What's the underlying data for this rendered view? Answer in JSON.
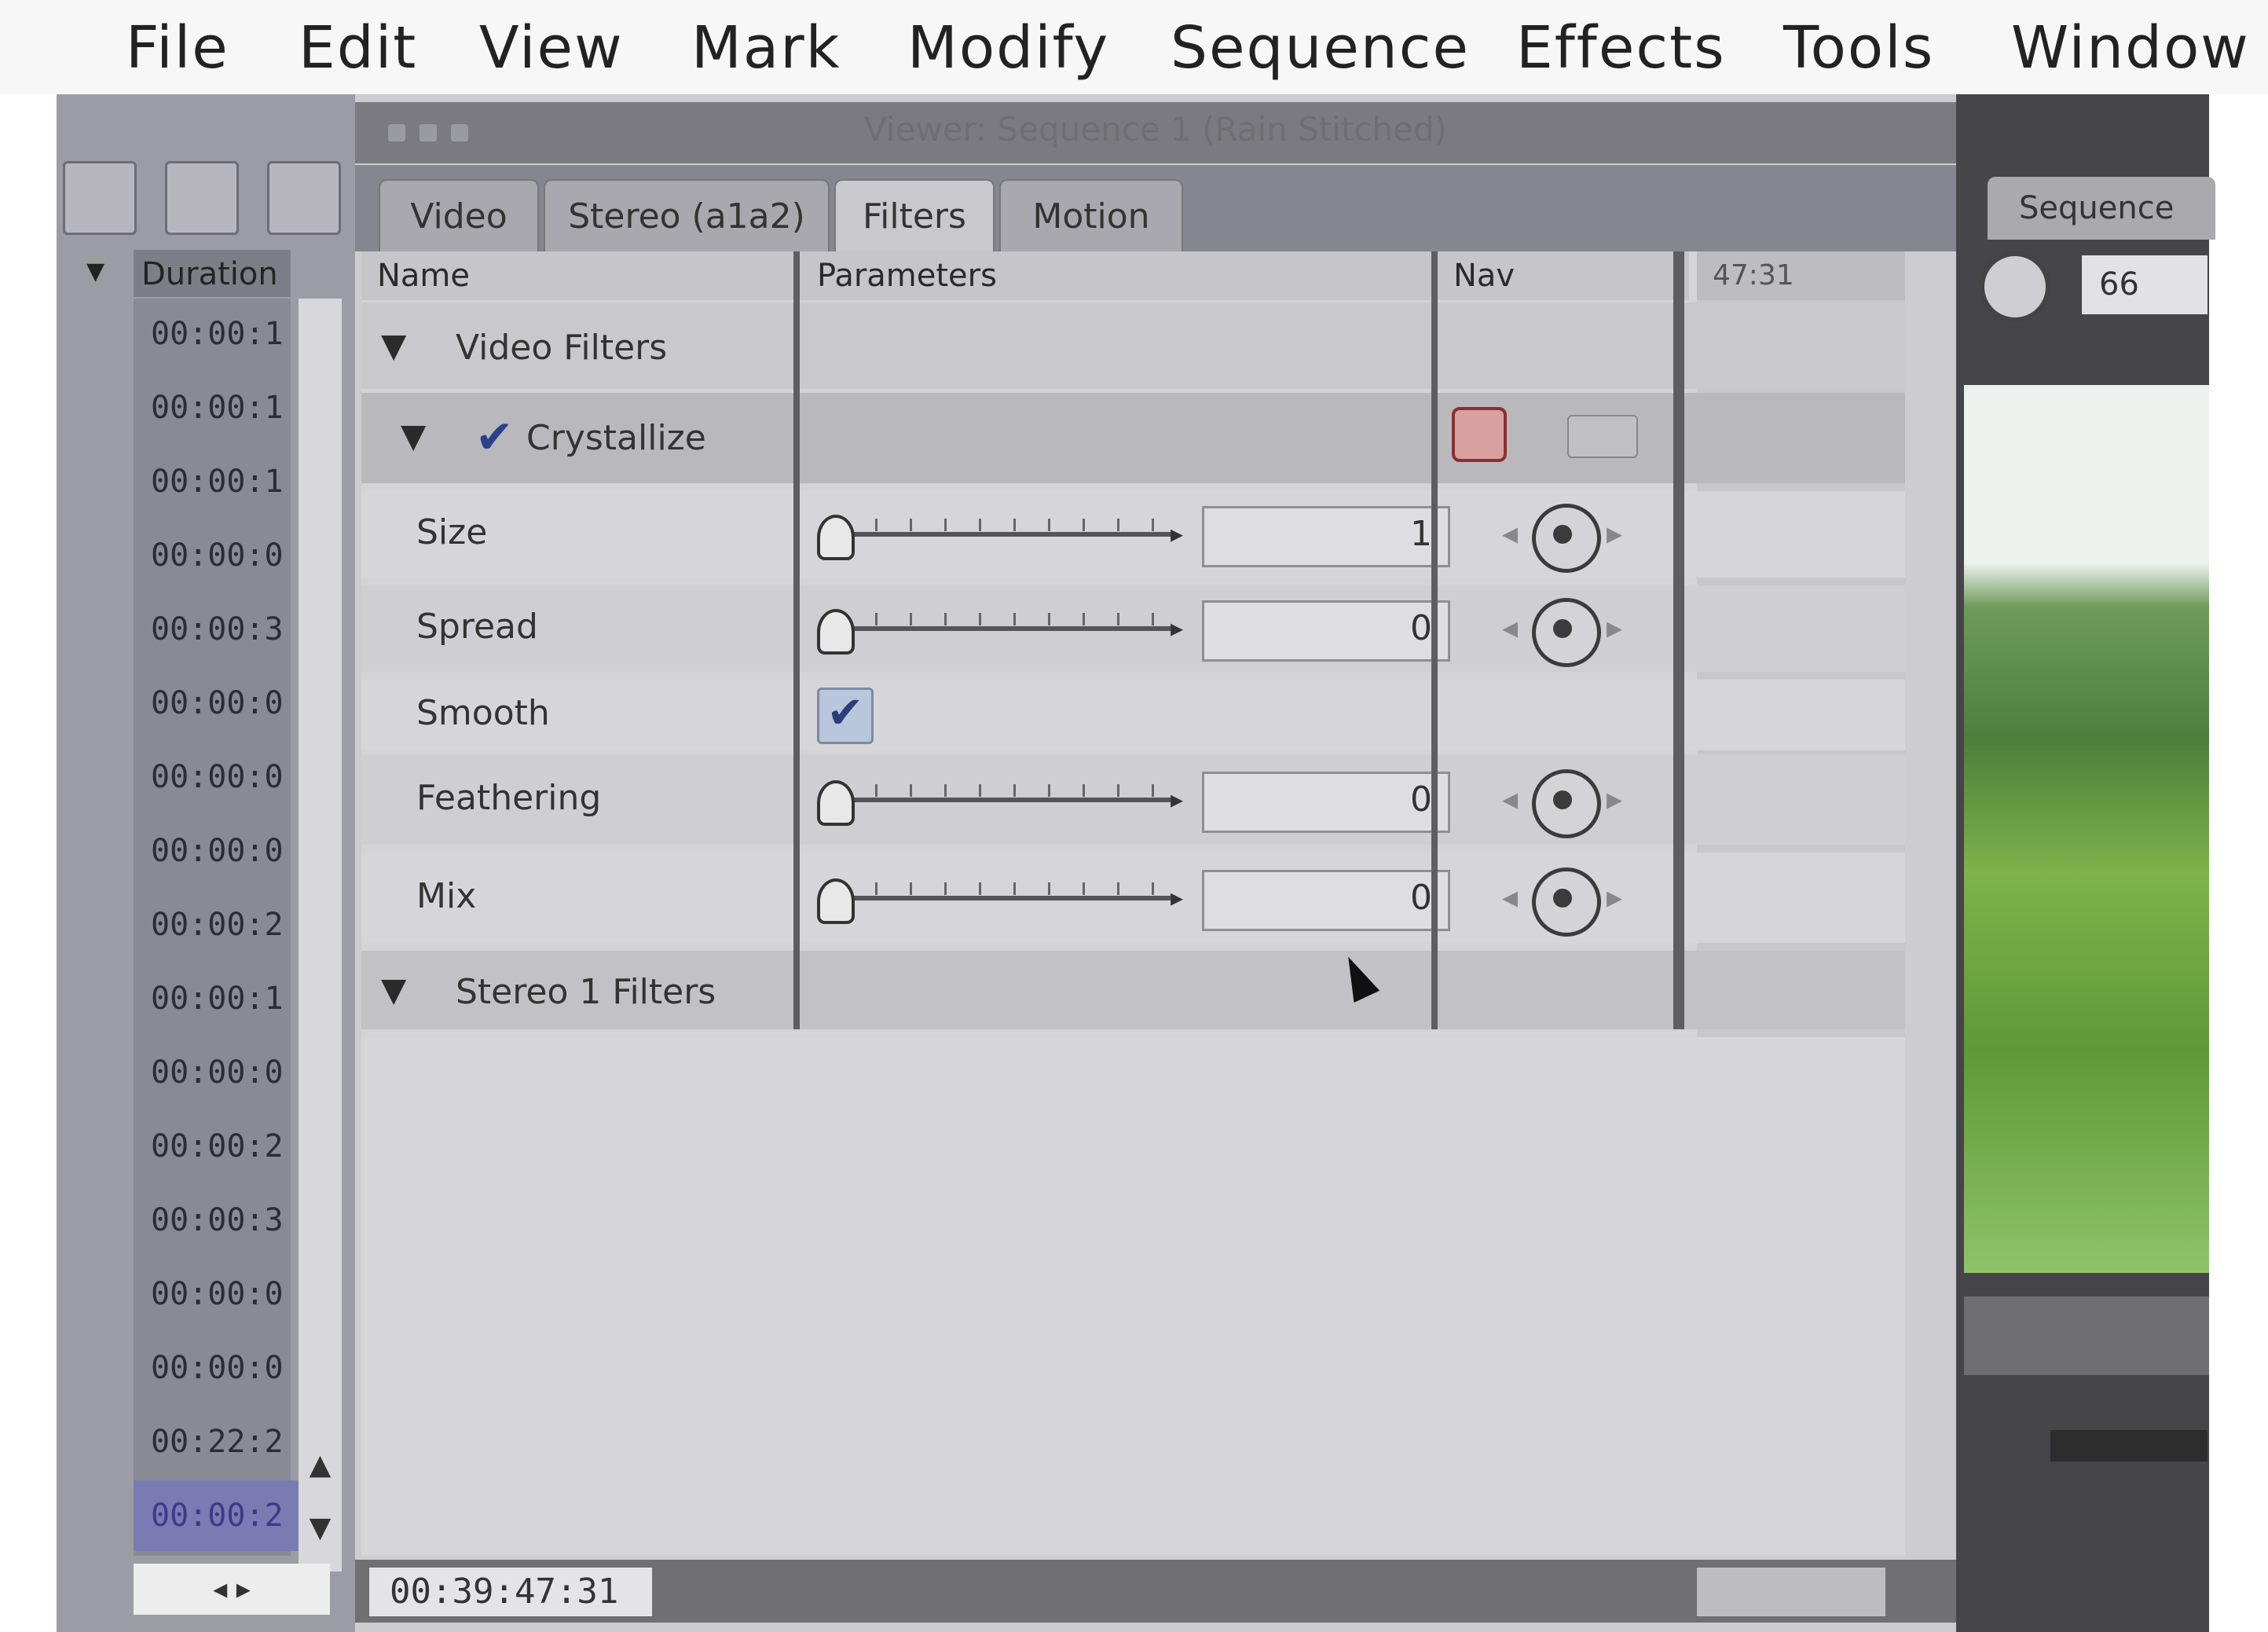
{
  "menu": [
    "File",
    "Edit",
    "View",
    "Mark",
    "Modify",
    "Sequence",
    "Effects",
    "Tools",
    "Window"
  ],
  "browser": {
    "column_header": "Duration",
    "durations": [
      "00:00:1",
      "00:00:1",
      "00:00:1",
      "00:00:0",
      "00:00:3",
      "00:00:0",
      "00:00:0",
      "00:00:0",
      "00:00:2",
      "00:00:1",
      "00:00:0",
      "00:00:2",
      "00:00:3",
      "00:00:0",
      "00:00:0",
      "00:22:2",
      "00:00:2"
    ],
    "selected_index": 16,
    "footer": "◂ ▸"
  },
  "viewer": {
    "title": "Viewer: Sequence 1 (Rain Stitched)",
    "tabs": [
      "Video",
      "Stereo (a1a2)",
      "Filters",
      "Motion"
    ],
    "active_tab": "Filters",
    "columns": {
      "name": "Name",
      "parameters": "Parameters",
      "nav": "Nav"
    },
    "video_filters_label": "Video Filters",
    "filter_name": "Crystallize",
    "filter_enabled": true,
    "params": [
      {
        "label": "Size",
        "value": "1"
      },
      {
        "label": "Spread",
        "value": "0"
      },
      {
        "label": "Smooth",
        "checked": true
      },
      {
        "label": "Feathering",
        "value": "0"
      },
      {
        "label": "Mix",
        "value": "0"
      }
    ],
    "stereo_filters_label": "Stereo 1 Filters",
    "timecode": "00:39:47:31",
    "kf_head": "47:31"
  },
  "canvas": {
    "tab": "Sequence",
    "field": "66"
  },
  "colors": {
    "menubar": "#f7f7f7",
    "panel": "#cdcdd1",
    "selection": "#7b7bb4"
  }
}
